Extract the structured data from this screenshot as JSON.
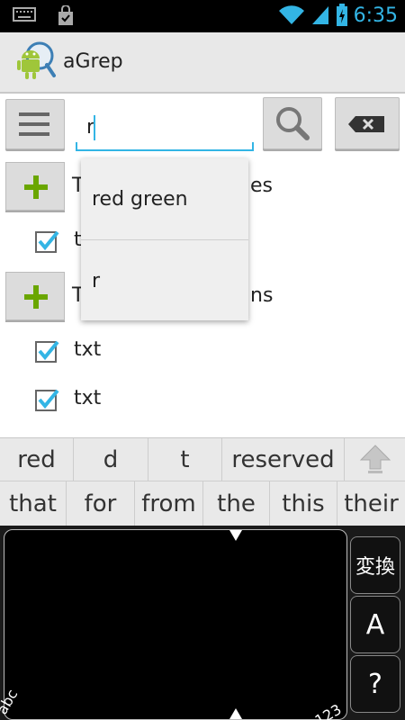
{
  "status_bar": {
    "time": "6:35",
    "icons": [
      "keyboard-icon",
      "bag-icon",
      "wifi-icon",
      "signal-icon",
      "battery-icon"
    ]
  },
  "app": {
    "title": "aGrep",
    "icon": "agrep-android-icon"
  },
  "search": {
    "value": "r",
    "menu_icon": "menu-lines-icon",
    "search_icon": "magnifier-icon",
    "clear_icon": "backspace-clear-icon"
  },
  "list": {
    "groups": [
      {
        "label_visible_start": "T",
        "label_visible_end": "es"
      },
      {
        "label_visible_start": "T",
        "label_visible_end": "ns"
      }
    ],
    "items": [
      {
        "text": "t",
        "checked": true
      },
      {
        "text": "txt",
        "checked": true
      },
      {
        "text": "txt",
        "checked": true
      }
    ]
  },
  "autocomplete": {
    "items": [
      "red green",
      "r"
    ]
  },
  "suggestions": {
    "row1": [
      "red",
      "d",
      "t",
      "reserved"
    ],
    "row2": [
      "that",
      "for",
      "from",
      "the",
      "this",
      "their"
    ]
  },
  "keyboard": {
    "keys": [
      "変換",
      "A",
      "?"
    ],
    "corner_left": "abc",
    "corner_right": "123"
  },
  "colors": {
    "accent": "#33b5e5",
    "check": "#33b5e5",
    "plus": "#6aa600"
  }
}
